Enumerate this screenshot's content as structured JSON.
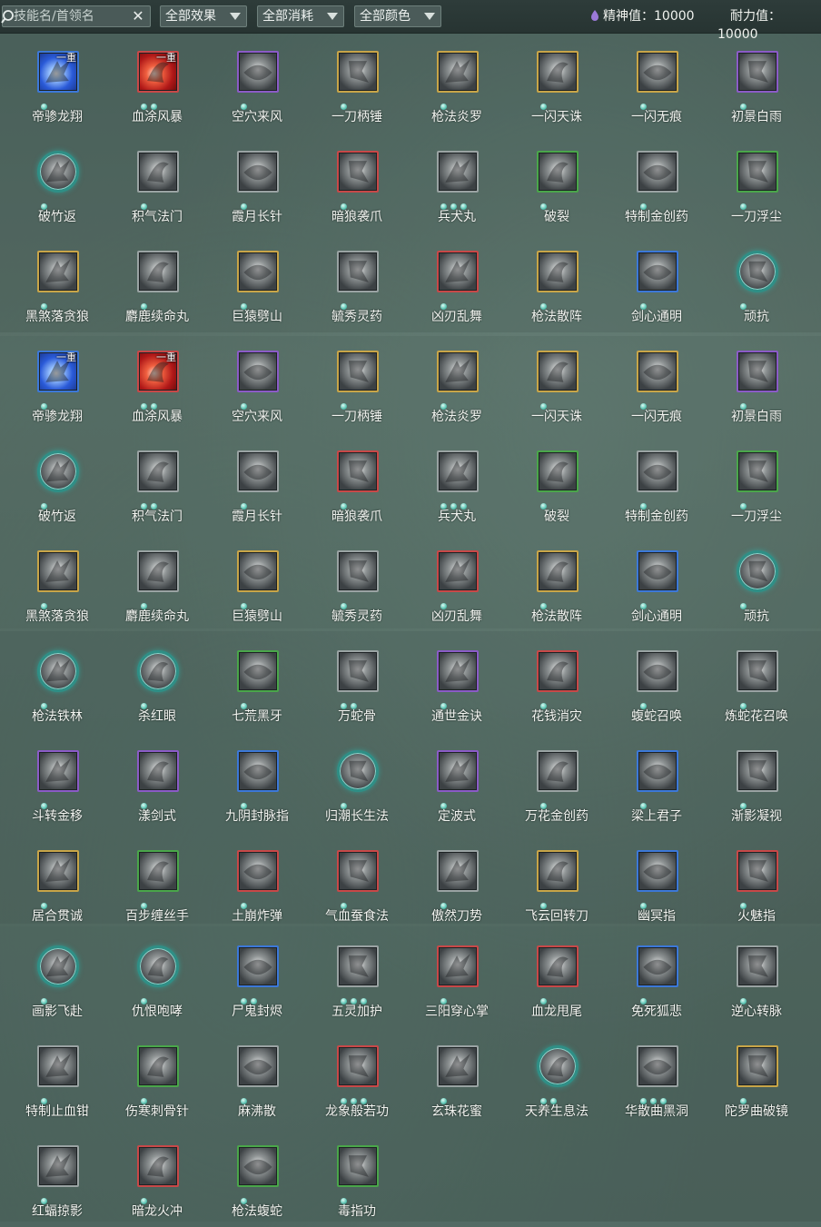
{
  "toolbar": {
    "search_placeholder": "技能名/首领名",
    "filter_effect": "全部效果",
    "filter_cost": "全部消耗",
    "filter_color": "全部颜色",
    "spirit": "精神值：10000",
    "stamina": "耐力值：10000"
  },
  "colors": {
    "purple": "#8b5bc7",
    "gold": "#c8a548",
    "red": "#c84848",
    "blue": "#3c78d8",
    "green": "#4aa64a",
    "gray": "#9aa3a3",
    "teal_ring": "#2f8f86"
  },
  "skills": [
    {
      "name": "帝骖龙翔",
      "frame": "blue",
      "dots": 1,
      "badge": "一重",
      "tint": "blue"
    },
    {
      "name": "血涂风暴",
      "frame": "red",
      "dots": 2,
      "badge": "一重",
      "tint": "red"
    },
    {
      "name": "空穴来风",
      "frame": "purple",
      "dots": 1
    },
    {
      "name": "一刀柄锤",
      "frame": "gold",
      "dots": 1
    },
    {
      "name": "枪法炎罗",
      "frame": "gold",
      "dots": 1
    },
    {
      "name": "一闪天诛",
      "frame": "gold",
      "dots": 1
    },
    {
      "name": "一闪无痕",
      "frame": "gold",
      "dots": 1
    },
    {
      "name": "初景白雨",
      "frame": "purple",
      "dots": 1
    },
    {
      "name": "破竹返",
      "frame": "circle",
      "dots": 1
    },
    {
      "name": "积气法门",
      "frame": "gray",
      "dots": 1
    },
    {
      "name": "霞月长针",
      "frame": "gray",
      "dots": 1
    },
    {
      "name": "暗狼袭爪",
      "frame": "red",
      "dots": 1
    },
    {
      "name": "兵犬丸",
      "frame": "gray",
      "dots": 3
    },
    {
      "name": "破裂",
      "frame": "green",
      "dots": 1
    },
    {
      "name": "特制金创药",
      "frame": "gray",
      "dots": 1
    },
    {
      "name": "一刀浮尘",
      "frame": "green",
      "dots": 1
    },
    {
      "name": "黑煞落贪狼",
      "frame": "gold",
      "dots": 1
    },
    {
      "name": "麝鹿续命丸",
      "frame": "gray",
      "dots": 1
    },
    {
      "name": "巨猿劈山",
      "frame": "gold",
      "dots": 1
    },
    {
      "name": "毓秀灵药",
      "frame": "gray",
      "dots": 1
    },
    {
      "name": "凶刃乱舞",
      "frame": "red",
      "dots": 1
    },
    {
      "name": "枪法散阵",
      "frame": "gold",
      "dots": 1
    },
    {
      "name": "剑心通明",
      "frame": "blue",
      "dots": 1
    },
    {
      "name": "顽抗",
      "frame": "circle",
      "dots": 1
    },
    {
      "name": "帝骖龙翔",
      "frame": "blue",
      "dots": 1,
      "badge": "一重",
      "tint": "blue"
    },
    {
      "name": "血涂风暴",
      "frame": "red",
      "dots": 2,
      "badge": "一重",
      "tint": "red"
    },
    {
      "name": "空穴来风",
      "frame": "purple",
      "dots": 1
    },
    {
      "name": "一刀柄锤",
      "frame": "gold",
      "dots": 1
    },
    {
      "name": "枪法炎罗",
      "frame": "gold",
      "dots": 1
    },
    {
      "name": "一闪天诛",
      "frame": "gold",
      "dots": 1
    },
    {
      "name": "一闪无痕",
      "frame": "gold",
      "dots": 1
    },
    {
      "name": "初景白雨",
      "frame": "purple",
      "dots": 1
    },
    {
      "name": "破竹返",
      "frame": "circle",
      "dots": 1
    },
    {
      "name": "积气法门",
      "frame": "gray",
      "dots": 2
    },
    {
      "name": "霞月长针",
      "frame": "gray",
      "dots": 1
    },
    {
      "name": "暗狼袭爪",
      "frame": "red",
      "dots": 1
    },
    {
      "name": "兵犬丸",
      "frame": "gray",
      "dots": 3
    },
    {
      "name": "破裂",
      "frame": "green",
      "dots": 1
    },
    {
      "name": "特制金创药",
      "frame": "gray",
      "dots": 1
    },
    {
      "name": "一刀浮尘",
      "frame": "green",
      "dots": 1
    },
    {
      "name": "黑煞落贪狼",
      "frame": "gold",
      "dots": 1
    },
    {
      "name": "麝鹿续命丸",
      "frame": "gray",
      "dots": 1
    },
    {
      "name": "巨猿劈山",
      "frame": "gold",
      "dots": 1
    },
    {
      "name": "毓秀灵药",
      "frame": "gray",
      "dots": 1
    },
    {
      "name": "凶刃乱舞",
      "frame": "red",
      "dots": 1
    },
    {
      "name": "枪法散阵",
      "frame": "gold",
      "dots": 1
    },
    {
      "name": "剑心通明",
      "frame": "blue",
      "dots": 1
    },
    {
      "name": "顽抗",
      "frame": "circle",
      "dots": 1
    },
    {
      "name": "枪法铁林",
      "frame": "circle",
      "dots": 1
    },
    {
      "name": "杀红眼",
      "frame": "circle",
      "dots": 1
    },
    {
      "name": "七荒黑牙",
      "frame": "green",
      "dots": 1
    },
    {
      "name": "万蛇骨",
      "frame": "gray",
      "dots": 2
    },
    {
      "name": "通世金诀",
      "frame": "purple",
      "dots": 1
    },
    {
      "name": "花钱消灾",
      "frame": "red",
      "dots": 1
    },
    {
      "name": "蝮蛇召唤",
      "frame": "gray",
      "dots": 1
    },
    {
      "name": "炼蛇花召唤",
      "frame": "gray",
      "dots": 1
    },
    {
      "name": "斗转金移",
      "frame": "purple",
      "dots": 1
    },
    {
      "name": "漾剑式",
      "frame": "purple",
      "dots": 1
    },
    {
      "name": "九阴封脉指",
      "frame": "blue",
      "dots": 1
    },
    {
      "name": "归潮长生法",
      "frame": "circle",
      "dots": 1
    },
    {
      "name": "定波式",
      "frame": "purple",
      "dots": 1
    },
    {
      "name": "万花金创药",
      "frame": "gray",
      "dots": 1
    },
    {
      "name": "梁上君子",
      "frame": "blue",
      "dots": 1
    },
    {
      "name": "渐影凝视",
      "frame": "gray",
      "dots": 1
    },
    {
      "name": "居合贯诚",
      "frame": "gold",
      "dots": 1
    },
    {
      "name": "百步缠丝手",
      "frame": "green",
      "dots": 1
    },
    {
      "name": "土崩炸弹",
      "frame": "red",
      "dots": 1
    },
    {
      "name": "气血蚕食法",
      "frame": "red",
      "dots": 1
    },
    {
      "name": "傲然刀势",
      "frame": "gray",
      "dots": 1
    },
    {
      "name": "飞云回转刀",
      "frame": "gold",
      "dots": 1
    },
    {
      "name": "幽冥指",
      "frame": "blue",
      "dots": 1
    },
    {
      "name": "火魅指",
      "frame": "red",
      "dots": 1
    },
    {
      "name": "画影飞赴",
      "frame": "circle",
      "dots": 1
    },
    {
      "name": "仇恨咆哮",
      "frame": "circle",
      "dots": 1
    },
    {
      "name": "尸鬼封烬",
      "frame": "blue",
      "dots": 2
    },
    {
      "name": "五灵加护",
      "frame": "gray",
      "dots": 3
    },
    {
      "name": "三阳穿心掌",
      "frame": "red",
      "dots": 1
    },
    {
      "name": "血龙甩尾",
      "frame": "red",
      "dots": 1
    },
    {
      "name": "免死狐悲",
      "frame": "blue",
      "dots": 1
    },
    {
      "name": "逆心转脉",
      "frame": "gray",
      "dots": 1
    },
    {
      "name": "特制止血钳",
      "frame": "gray",
      "dots": 1
    },
    {
      "name": "伤寒刺骨针",
      "frame": "green",
      "dots": 1
    },
    {
      "name": "麻沸散",
      "frame": "gray",
      "dots": 1
    },
    {
      "name": "龙象般若功",
      "frame": "red",
      "dots": 3
    },
    {
      "name": "玄珠花蜜",
      "frame": "gray",
      "dots": 1
    },
    {
      "name": "天养生息法",
      "frame": "circle",
      "dots": 2
    },
    {
      "name": "华散曲黑洞",
      "frame": "gray",
      "dots": 3
    },
    {
      "name": "陀罗曲破镜",
      "frame": "gold",
      "dots": 1
    },
    {
      "name": "红蝠掠影",
      "frame": "gray",
      "dots": 1
    },
    {
      "name": "暗龙火冲",
      "frame": "red",
      "dots": 1
    },
    {
      "name": "枪法蝮蛇",
      "frame": "green",
      "dots": 1
    },
    {
      "name": "毒指功",
      "frame": "green",
      "dots": 1
    }
  ]
}
